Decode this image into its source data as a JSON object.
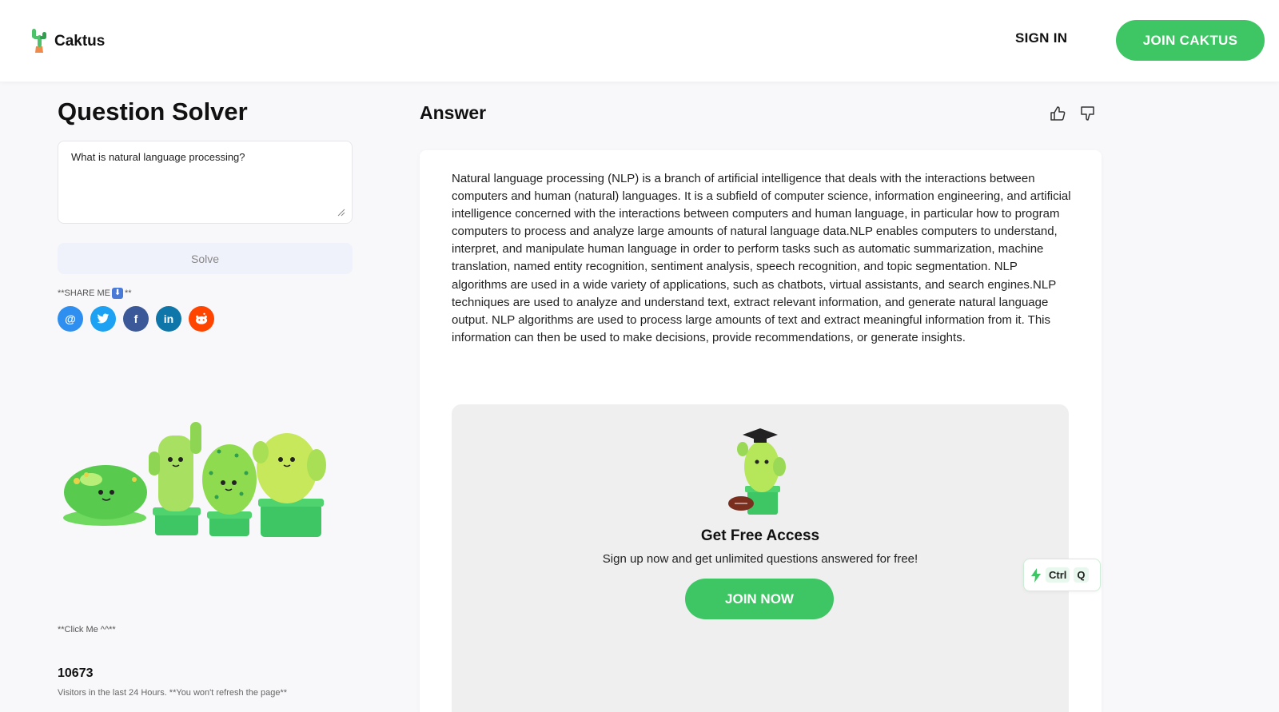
{
  "brand": {
    "name": "Caktus",
    "accent": "#3ec564"
  },
  "header": {
    "signin_label": "SIGN IN",
    "join_label": "JOIN CAKTUS"
  },
  "solver": {
    "title": "Question Solver",
    "question_value": "What is natural language processing?",
    "solve_label": "Solve",
    "share_label_prefix": "**SHARE ME",
    "share_label_suffix": "**",
    "share_icons": [
      "email-icon",
      "twitter-icon",
      "facebook-icon",
      "linkedin-icon",
      "reddit-icon"
    ],
    "click_me": "**Click Me ^^**",
    "visitors_count": "10673",
    "visitors_note": "Visitors in the last 24 Hours. **You won't refresh the page**"
  },
  "answer": {
    "title": "Answer",
    "text": "Natural language processing (NLP) is a branch of artificial intelligence that deals with the interactions between computers and human (natural) languages. It is a subfield of computer science, information engineering, and artificial intelligence concerned with the interactions between computers and human language, in particular how to program computers to process and analyze large amounts of natural language data.NLP enables computers to understand, interpret, and manipulate human language in order to perform tasks such as automatic summarization, machine translation, named entity recognition, sentiment analysis, speech recognition, and topic segmentation. NLP algorithms are used in a wide variety of applications, such as chatbots, virtual assistants, and search engines.NLP techniques are used to analyze and understand text, extract relevant information, and generate natural language output. NLP algorithms are used to process large amounts of text and extract meaningful information from it. This information can then be used to make decisions, provide recommendations, or generate insights."
  },
  "access": {
    "title": "Get Free Access",
    "subtitle": "Sign up now and get unlimited questions answered for free!",
    "join_label": "JOIN NOW"
  },
  "shortcut": {
    "key1": "Ctrl",
    "key2": "Q"
  }
}
